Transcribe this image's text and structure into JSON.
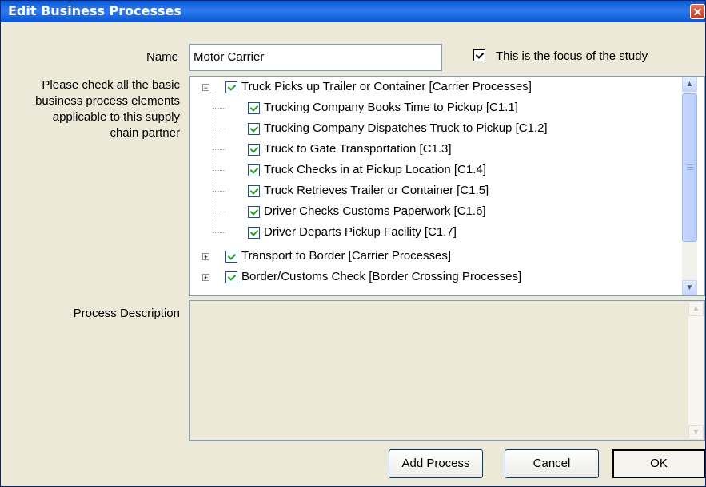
{
  "window": {
    "title": "Edit Business Processes",
    "close_glyph": "✕"
  },
  "form": {
    "name_label": "Name",
    "name_value": "Motor Carrier",
    "focus_checkbox": {
      "label": "This is the focus of the study",
      "checked": true
    },
    "instructions_label": "Please check all the basic business process elements applicable to this supply chain partner",
    "description_label": "Process Description",
    "description_value": ""
  },
  "tree": {
    "items": [
      {
        "label": "Truck Picks up Trailer or Container [Carrier Processes]",
        "level": 0,
        "expanded": true,
        "checked": true
      },
      {
        "label": "Trucking Company Books Time to Pickup [C1.1]",
        "level": 1,
        "checked": true
      },
      {
        "label": "Trucking Company Dispatches Truck to Pickup [C1.2]",
        "level": 1,
        "checked": true
      },
      {
        "label": "Truck to Gate Transportation [C1.3]",
        "level": 1,
        "checked": true
      },
      {
        "label": "Truck Checks in at Pickup Location [C1.4]",
        "level": 1,
        "checked": true
      },
      {
        "label": "Truck Retrieves Trailer or Container [C1.5]",
        "level": 1,
        "checked": true
      },
      {
        "label": "Driver Checks Customs Paperwork [C1.6]",
        "level": 1,
        "checked": true
      },
      {
        "label": "Driver Departs Pickup Facility [C1.7]",
        "level": 1,
        "checked": true
      },
      {
        "label": "Transport to Border [Carrier Processes]",
        "level": 0,
        "expanded": false,
        "checked": true
      },
      {
        "label": "Border/Customs Check [Border Crossing Processes]",
        "level": 0,
        "expanded": false,
        "checked": true
      }
    ]
  },
  "buttons": {
    "add_process": "Add Process",
    "cancel": "Cancel",
    "ok": "OK"
  },
  "colors": {
    "titlebar": "#0a58d6",
    "dialog_bg": "#ece9d8",
    "check_green": "#21a121"
  }
}
